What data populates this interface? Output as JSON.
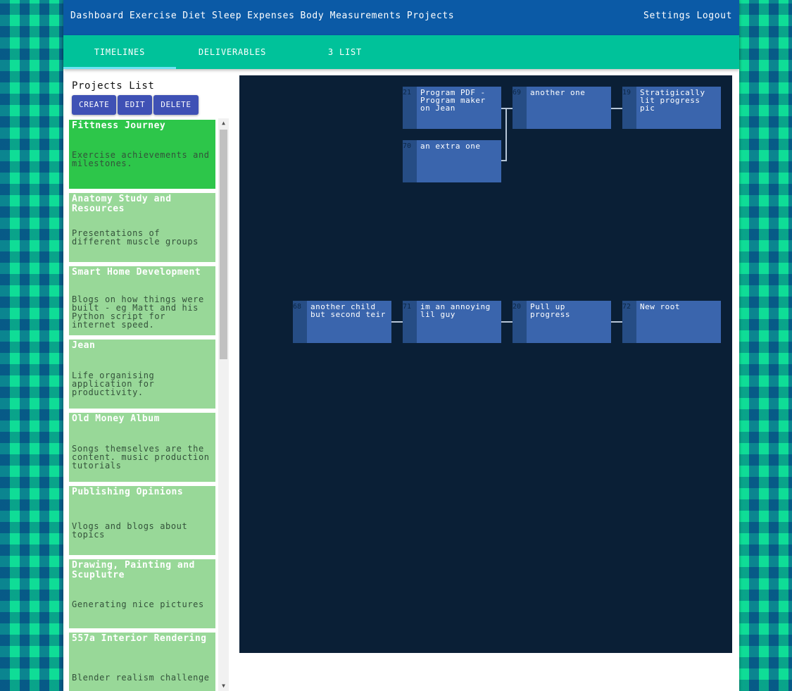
{
  "nav": {
    "left": [
      "Dashboard",
      "Exercise",
      "Diet",
      "Sleep",
      "Expenses",
      "Body Measurements",
      "Projects"
    ],
    "right": [
      "Settings",
      "Logout"
    ]
  },
  "tabs": [
    "TIMELINES",
    "DELIVERABLES",
    "3 LIST"
  ],
  "sidebar": {
    "title": "Projects List",
    "buttons": [
      "CREATE",
      "EDIT",
      "DELETE"
    ],
    "projects": [
      {
        "title": "Fittness Journey",
        "desc": "Exercise achievements and milestones."
      },
      {
        "title": "Anatomy Study and Resources",
        "desc": "Presentations of different muscle groups"
      },
      {
        "title": "Smart Home Development",
        "desc": "Blogs on how things were built - eg Matt and his Python script for internet speed."
      },
      {
        "title": "Jean",
        "desc": "Life organising application for productivity."
      },
      {
        "title": "Old Money Album",
        "desc": "Songs themselves are the content. music production tutorials"
      },
      {
        "title": "Publishing Opinions",
        "desc": "Vlogs and blogs about topics"
      },
      {
        "title": "Drawing, Painting and Scuplutre",
        "desc": "Generating nice pictures"
      },
      {
        "title": "557a Interior Rendering",
        "desc": "Blender realism challenge"
      }
    ]
  },
  "timeline": {
    "nodes": [
      {
        "id": "21",
        "label": "Program PDF - Program maker on Jean"
      },
      {
        "id": "69",
        "label": "another one"
      },
      {
        "id": "19",
        "label": "Stratigically lit progress pic"
      },
      {
        "id": "70",
        "label": "an extra one"
      },
      {
        "id": "68",
        "label": "another child but second teir"
      },
      {
        "id": "71",
        "label": "im an annoying lil guy"
      },
      {
        "id": "20",
        "label": "Pull up progress"
      },
      {
        "id": "72",
        "label": "New root"
      }
    ]
  }
}
